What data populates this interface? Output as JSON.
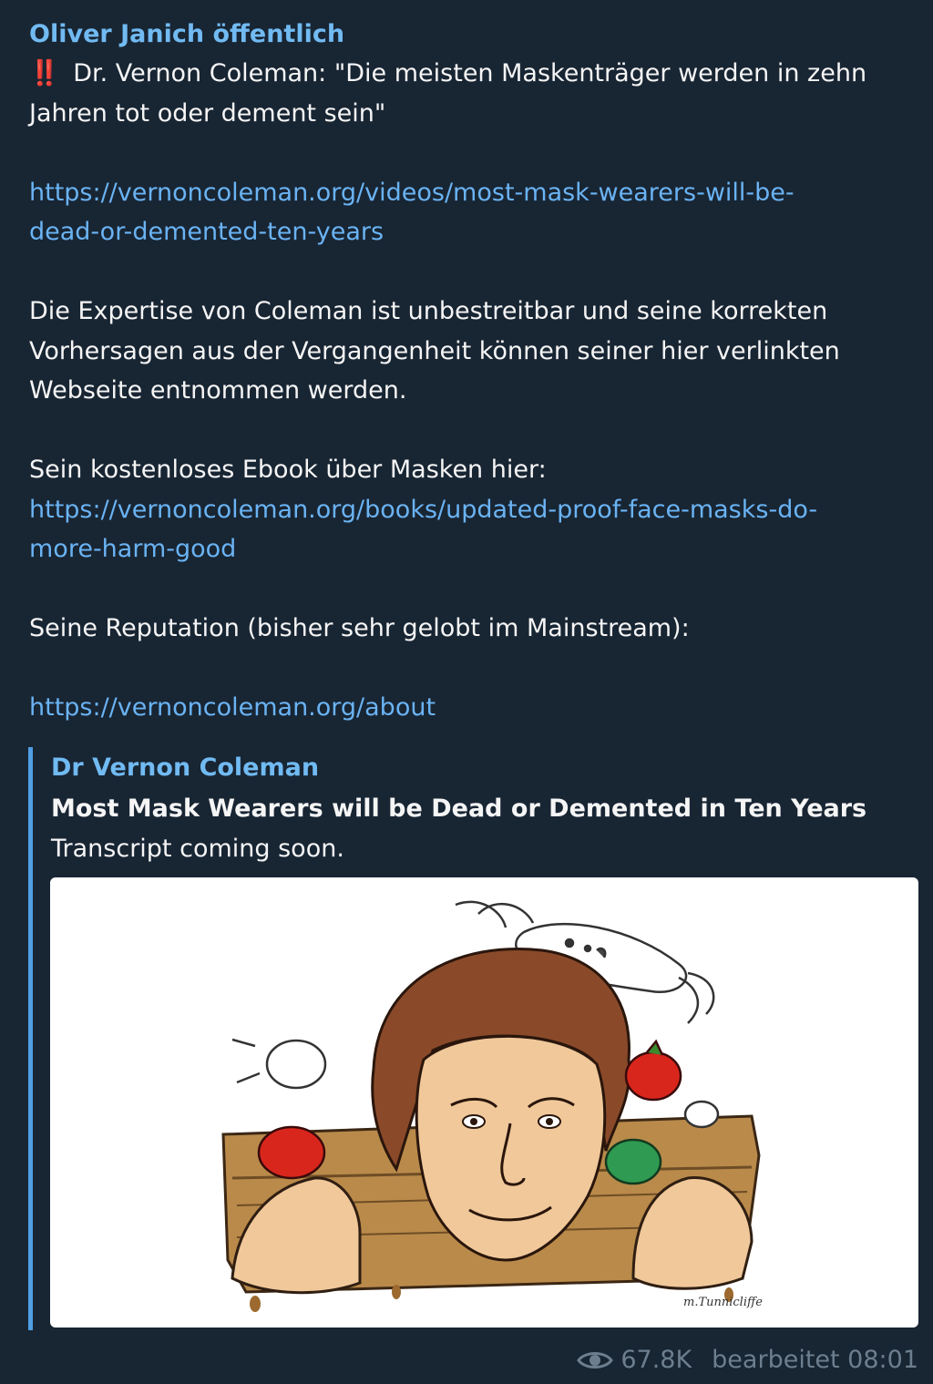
{
  "message": {
    "channel_name": "Oliver Janich öffentlich",
    "alert_emoji": "‼️",
    "headline_line1": " Dr. Vernon Coleman: \"Die meisten Maskenträger werden in zehn",
    "headline_line2": "Jahren tot oder dement sein\"",
    "link1_line1": "https://vernoncoleman.org/videos/most-mask-wearers-will-be-",
    "link1_line2": "dead-or-demented-ten-years",
    "para1_line1": "Die Expertise von Coleman ist unbestreitbar und seine korrekten",
    "para1_line2": "Vorhersagen aus der Vergangenheit können seiner hier verlinkten",
    "para1_line3": "Webseite entnommen werden.",
    "ebook_text": "Sein kostenloses Ebook über Masken hier:",
    "link2_line1": "https://vernoncoleman.org/books/updated-proof-face-masks-do-",
    "link2_line2": "more-harm-good",
    "reputation_text": "Seine Reputation (bisher sehr gelobt im Mainstream):",
    "link3": "https://vernoncoleman.org/about"
  },
  "link_preview": {
    "site_name": "Dr Vernon Coleman",
    "title": "Most Mask Wearers will be Dead or Demented in Ten Years",
    "description": "Transcript coming soon.",
    "image_signature": "m.Tunnicliffe"
  },
  "footer": {
    "views": "67.8K",
    "edited_label": "bearbeitet 08:01"
  },
  "colors": {
    "background": "#182533",
    "link": "#6ab3f3",
    "channel_name": "#71baf2",
    "preview_bar": "#4f9ee3",
    "meta": "#6d7f8f"
  }
}
